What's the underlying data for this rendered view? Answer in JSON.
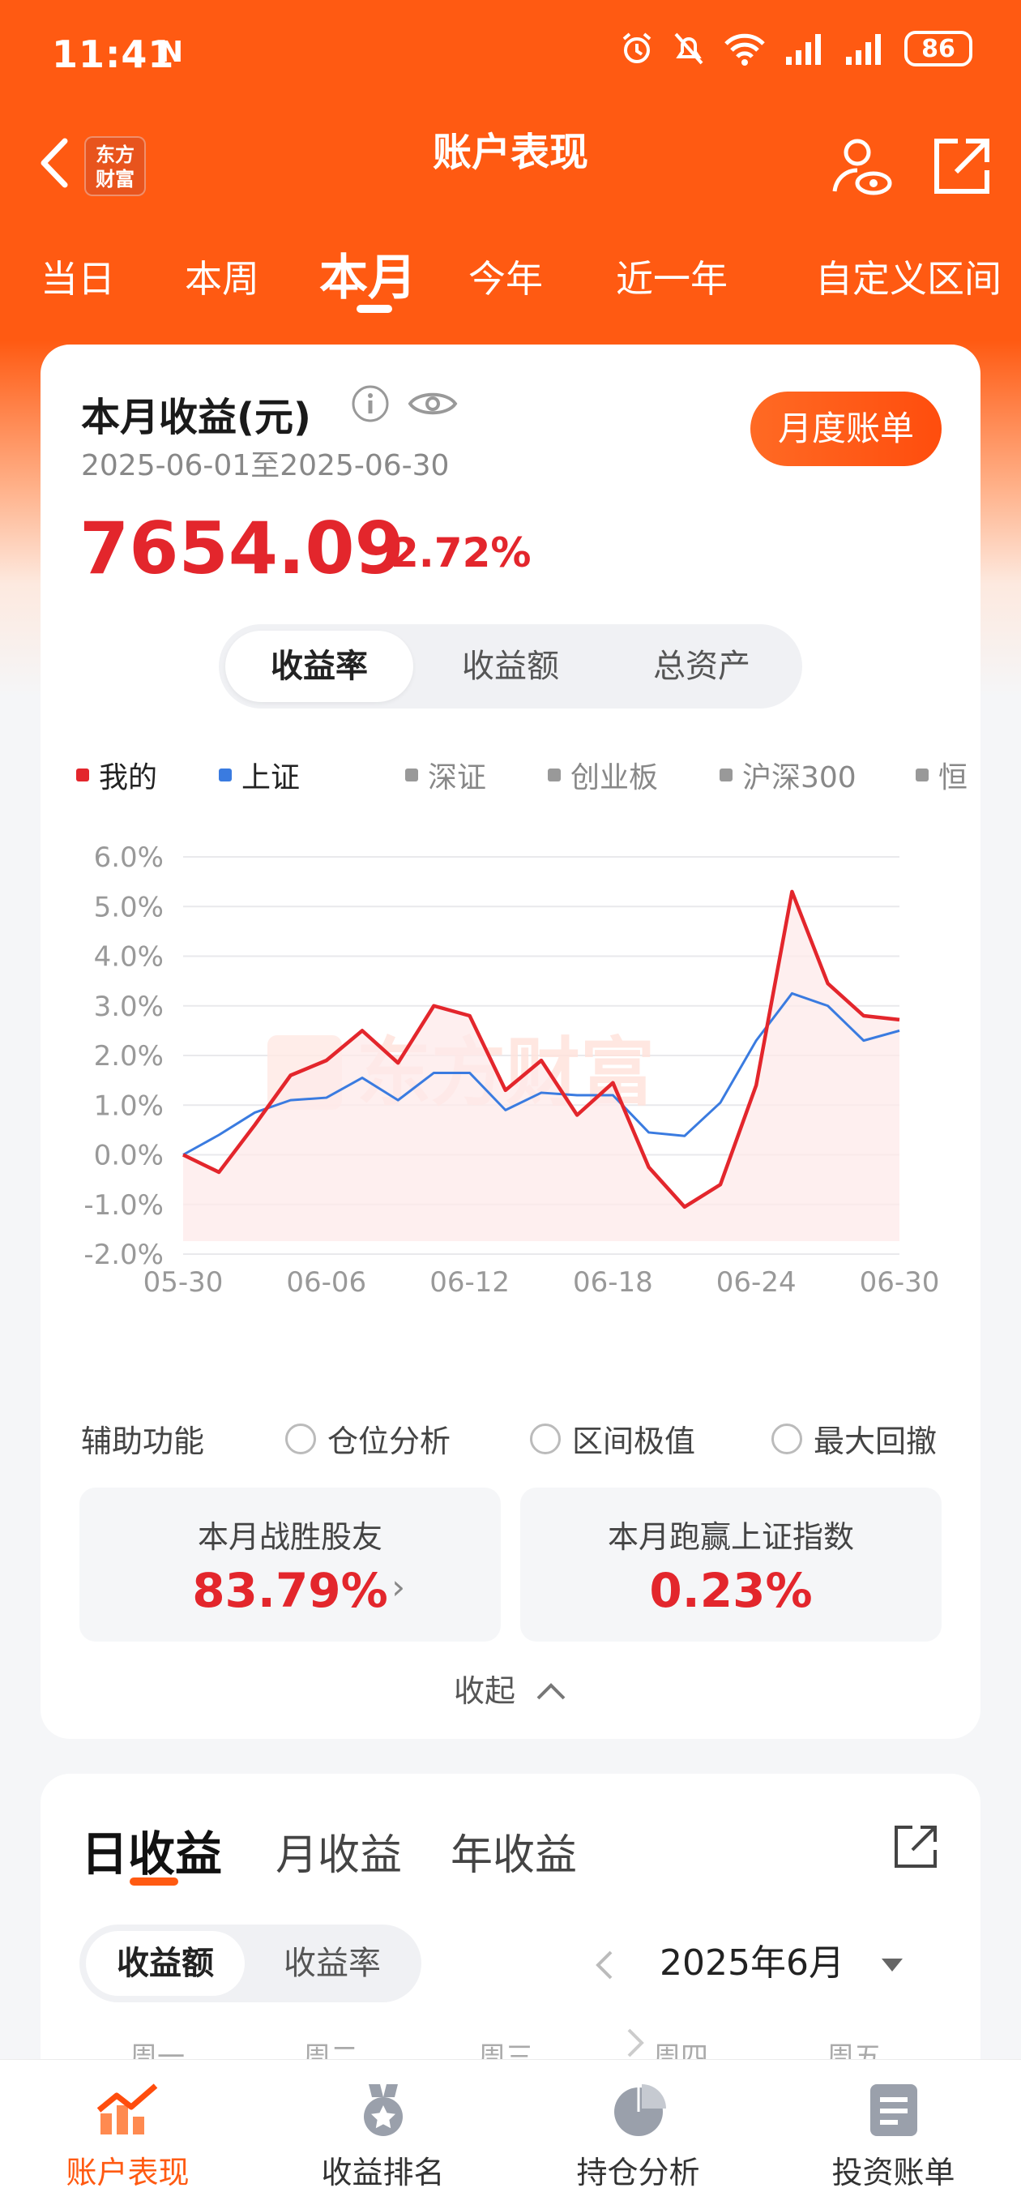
{
  "status": {
    "time": "11:41",
    "battery": "86"
  },
  "header": {
    "title": "账户表现",
    "logo_text": "东方\n财富"
  },
  "period_tabs": [
    "当日",
    "本周",
    "本月",
    "今年",
    "近一年",
    "自定义区间"
  ],
  "summary": {
    "title": "本月收益(元)",
    "date_range": "2025-06-01至2025-06-30",
    "monthly_bill_button": "月度账单",
    "value": "7654.09",
    "percent": "2.72%"
  },
  "metric_tabs": [
    "收益率",
    "收益额",
    "总资产"
  ],
  "legend": [
    "我的",
    "上证",
    "深证",
    "创业板",
    "沪深300",
    "恒"
  ],
  "watermark": "东方财富",
  "chart_data": {
    "type": "line",
    "x": [
      "05-30",
      "06-03",
      "06-04",
      "06-05",
      "06-06",
      "06-09",
      "06-10",
      "06-11",
      "06-12",
      "06-13",
      "06-16",
      "06-17",
      "06-18",
      "06-19",
      "06-20",
      "06-23",
      "06-24",
      "06-25",
      "06-26",
      "06-27",
      "06-30"
    ],
    "x_ticks": [
      "05-30",
      "06-06",
      "06-12",
      "06-18",
      "06-24",
      "06-30"
    ],
    "y_ticks": [
      "6.0%",
      "5.0%",
      "4.0%",
      "3.0%",
      "2.0%",
      "1.0%",
      "0.0%",
      "-1.0%",
      "-2.0%"
    ],
    "ylim": [
      -2.0,
      6.0
    ],
    "series": [
      {
        "name": "我的",
        "color": "#e3262c",
        "values": [
          0.0,
          -0.35,
          0.6,
          1.6,
          1.9,
          2.5,
          1.85,
          3.0,
          2.8,
          1.3,
          1.9,
          0.8,
          1.45,
          -0.25,
          -1.05,
          -0.6,
          1.4,
          5.3,
          3.45,
          2.8,
          2.72
        ]
      },
      {
        "name": "上证",
        "color": "#3a7be0",
        "values": [
          0.0,
          0.4,
          0.85,
          1.1,
          1.15,
          1.55,
          1.1,
          1.65,
          1.65,
          0.9,
          1.25,
          1.2,
          1.2,
          0.45,
          0.38,
          1.05,
          2.3,
          3.25,
          3.0,
          2.3,
          2.5
        ]
      }
    ]
  },
  "assist": {
    "label": "辅助功能",
    "options": [
      "仓位分析",
      "区间极值",
      "最大回撤"
    ]
  },
  "stats": [
    {
      "title": "本月战胜股友",
      "value": "83.79%"
    },
    {
      "title": "本月跑赢上证指数",
      "value": "0.23%"
    }
  ],
  "collapse_label": "收起",
  "earnings": {
    "tabs": [
      "日收益",
      "月收益",
      "年收益"
    ],
    "toggle": [
      "收益额",
      "收益率"
    ],
    "month": "2025年6月",
    "weekdays": [
      "周一",
      "周二",
      "周三",
      "周四",
      "周五"
    ]
  },
  "bottom_nav": [
    "账户表现",
    "收益排名",
    "持仓分析",
    "投资账单"
  ],
  "colors": {
    "brand": "#ff5a12",
    "up_red": "#e3262c",
    "index_blue": "#3a7be0"
  }
}
